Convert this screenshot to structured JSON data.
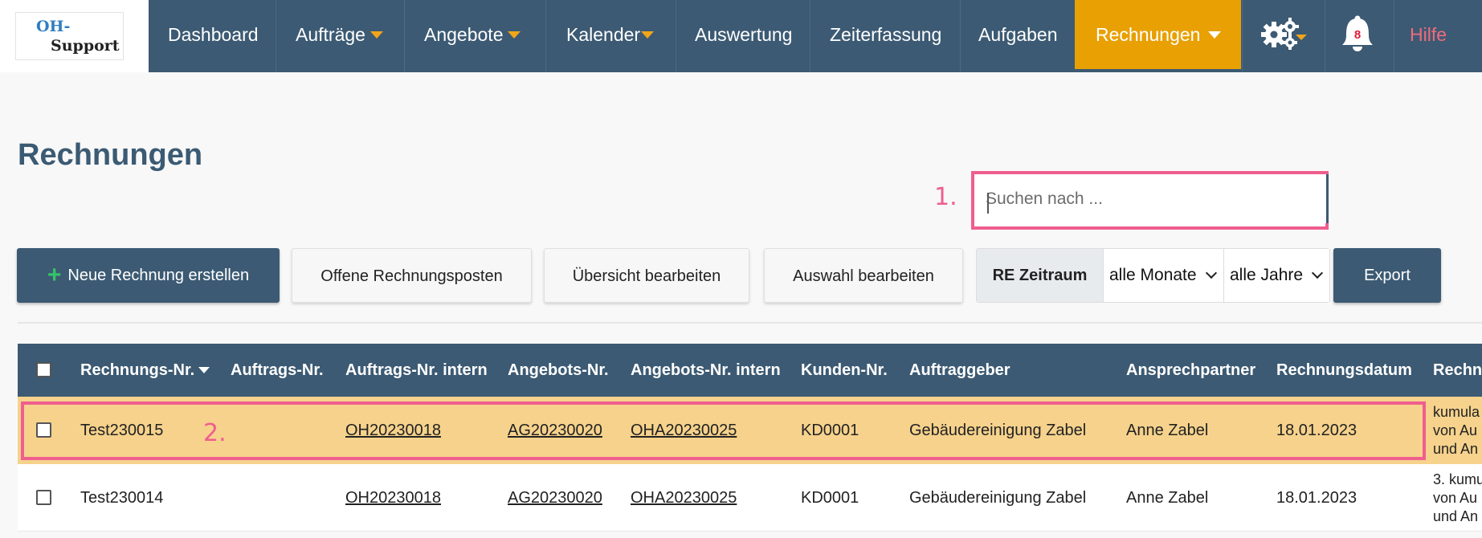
{
  "logo": {
    "line1": "OH-",
    "line2": "Support"
  },
  "nav": {
    "items": [
      {
        "label": "Dashboard"
      },
      {
        "label": "Aufträge"
      },
      {
        "label": "Angebote"
      },
      {
        "label": "Kalender"
      },
      {
        "label": "Auswertung"
      },
      {
        "label": "Zeiterfassung"
      },
      {
        "label": "Aufgaben"
      },
      {
        "label": "Rechnungen"
      }
    ],
    "notification_count": "8",
    "help_label": "Hilfe",
    "active_color": "#e8a003",
    "bar_color": "#3c5a73"
  },
  "page": {
    "title": "Rechnungen"
  },
  "annotations": {
    "first": "1.",
    "second": "2.",
    "color": "#ef5e8e"
  },
  "search": {
    "placeholder": "Suchen nach ...",
    "value": ""
  },
  "toolbar": {
    "new_invoice": "Neue Rechnung erstellen",
    "open_items": "Offene Rechnungsposten",
    "edit_overview": "Übersicht bearbeiten",
    "edit_selection": "Auswahl bearbeiten",
    "period_label": "RE Zeitraum",
    "months_selected": "alle Monate",
    "years_selected": "alle Jahre",
    "export": "Export"
  },
  "table": {
    "headers": [
      "Rechnungs-Nr.",
      "Auftrags-Nr.",
      "Auftrags-Nr. intern",
      "Angebots-Nr.",
      "Angebots-Nr. intern",
      "Kunden-Nr.",
      "Auftraggeber",
      "Ansprechpartner",
      "Rechnungsdatum",
      "Rechnu"
    ],
    "rows": [
      {
        "rechnungs_nr": "Test230015",
        "auftrags_nr": "",
        "auftrags_nr_intern": "OH20230018",
        "angebots_nr": "AG20230020",
        "angebots_nr_intern": "OHA20230025",
        "kunden_nr": "KD0001",
        "auftraggeber": "Gebäudereinigung Zabel",
        "ansprechpartner": "Anne Zabel",
        "rechnungsdatum": "18.01.2023",
        "rechnung_l1": "kumula",
        "rechnung_l2": "von Au",
        "rechnung_l3": "und An"
      },
      {
        "rechnungs_nr": "Test230014",
        "auftrags_nr": "",
        "auftrags_nr_intern": "OH20230018",
        "angebots_nr": "AG20230020",
        "angebots_nr_intern": "OHA20230025",
        "kunden_nr": "KD0001",
        "auftraggeber": "Gebäudereinigung Zabel",
        "ansprechpartner": "Anne Zabel",
        "rechnungsdatum": "18.01.2023",
        "rechnung_l1": "3. kumu",
        "rechnung_l2": "von Au",
        "rechnung_l3": "und An"
      }
    ]
  }
}
